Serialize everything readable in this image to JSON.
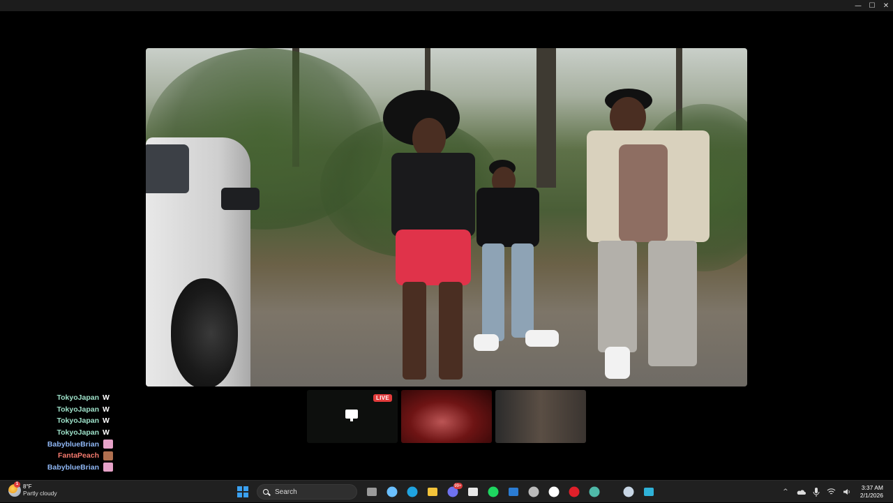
{
  "window": {
    "controls": {
      "minimize": "—",
      "maximize": "☐",
      "close": "✕"
    }
  },
  "player": {
    "scene": "video-frame"
  },
  "thumbnails": [
    {
      "name": "stream-thumbnail-1",
      "badge": "LIVE"
    },
    {
      "name": "stream-thumbnail-2"
    },
    {
      "name": "stream-thumbnail-3"
    }
  ],
  "chat": {
    "messages": [
      {
        "user": "TokyoJapan",
        "message": "W",
        "color": "#9de0c8"
      },
      {
        "user": "TokyoJapan",
        "message": "W",
        "color": "#9de0c8"
      },
      {
        "user": "TokyoJapan",
        "message": "W",
        "color": "#9de0c8"
      },
      {
        "user": "TokyoJapan",
        "message": "W",
        "color": "#9de0c8"
      },
      {
        "user": "BabyblueBrian",
        "message": "",
        "color": "#8fb7f5",
        "emote": "#e6a2c8"
      },
      {
        "user": "FantaPeach",
        "message": "",
        "color": "#f47a6e",
        "emote": "#b07050"
      },
      {
        "user": "BabyblueBrian",
        "message": "",
        "color": "#8fb7f5",
        "emote": "#e6a2c8"
      }
    ]
  },
  "taskbar": {
    "weather": {
      "temp": "8°F",
      "condition": "Partly cloudy",
      "badge": "1"
    },
    "search_label": "Search",
    "apps": [
      {
        "icon": "windows-start-icon",
        "color": "#3aa0f0"
      },
      {
        "icon": "search-box"
      },
      {
        "icon": "task-view-icon",
        "color": "#9a9a9a"
      },
      {
        "icon": "copilot-icon",
        "color": "#6ac0ff"
      },
      {
        "icon": "edge-icon",
        "color": "#1fa3e0"
      },
      {
        "icon": "file-explorer-icon",
        "color": "#f3c33a"
      },
      {
        "icon": "discord-icon",
        "color": "#6f72f0",
        "badge": "99+"
      },
      {
        "icon": "store-icon",
        "color": "#e8e8e8"
      },
      {
        "icon": "spotify-icon",
        "color": "#1ed760"
      },
      {
        "icon": "mail-icon",
        "color": "#2b7cd3"
      },
      {
        "icon": "chrome-recorder-icon",
        "color": "#bbbbbb"
      },
      {
        "icon": "tiktok-icon",
        "color": "#ffffff"
      },
      {
        "icon": "opera-icon",
        "color": "#e0202a"
      },
      {
        "icon": "globe-icon",
        "color": "#4fb9a8"
      },
      {
        "icon": "steam-icon",
        "color": "#c8d6e5"
      },
      {
        "icon": "app-f-icon",
        "color": "#2fb2d8"
      }
    ],
    "tray": {
      "chevron": "^",
      "time": "3:37 AM",
      "date": "2/1/2026"
    }
  }
}
